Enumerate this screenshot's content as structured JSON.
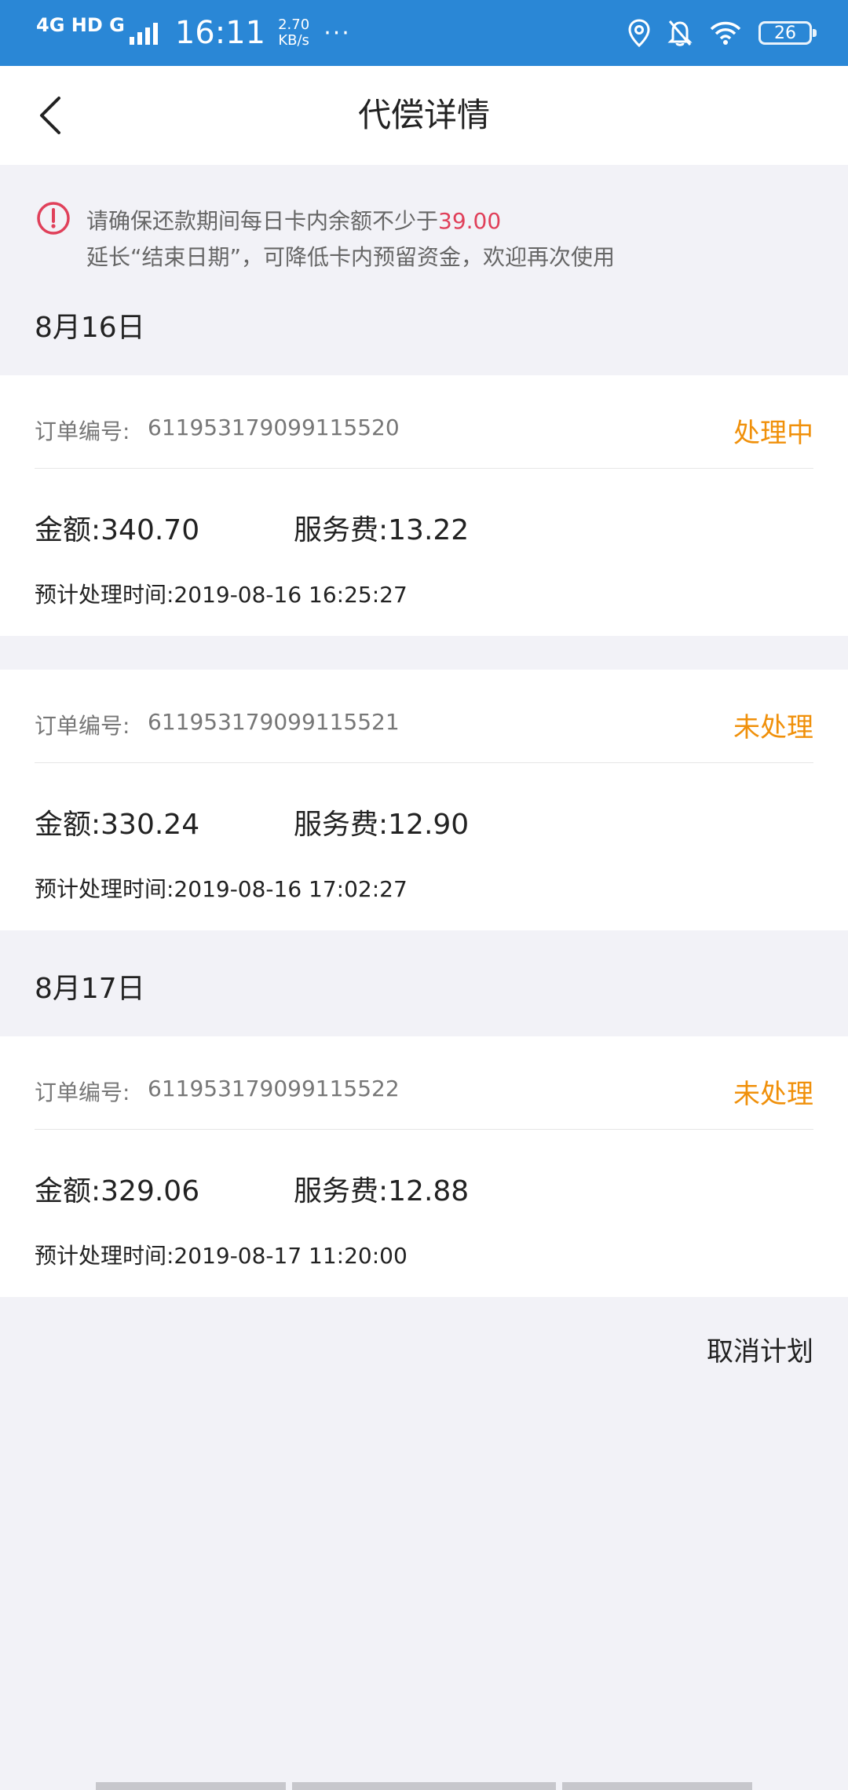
{
  "status_bar": {
    "network": "4G HD G",
    "time": "16:11",
    "speed_value": "2.70",
    "speed_unit": "KB/s",
    "more": "···",
    "battery": "26"
  },
  "header": {
    "title": "代偿详情"
  },
  "notice": {
    "line1_prefix": "请确保还款期间每日卡内余额不少于",
    "line1_amount": "39.00",
    "line2": "延长“结束日期”，可降低卡内预留资金，欢迎再次使用",
    "accent_color": "#e0405a"
  },
  "groups": [
    {
      "date": "8月16日",
      "orders": [
        {
          "order_label": "订单编号:",
          "order_no": "611953179099115520",
          "status": "处理中",
          "amount": "金额:340.70",
          "fee": "服务费:13.22",
          "time": "预计处理时间:2019-08-16 16:25:27"
        },
        {
          "order_label": "订单编号:",
          "order_no": "611953179099115521",
          "status": "未处理",
          "amount": "金额:330.24",
          "fee": "服务费:12.90",
          "time": "预计处理时间:2019-08-16 17:02:27"
        }
      ]
    },
    {
      "date": "8月17日",
      "orders": [
        {
          "order_label": "订单编号:",
          "order_no": "611953179099115522",
          "status": "未处理",
          "amount": "金额:329.06",
          "fee": "服务费:12.88",
          "time": "预计处理时间:2019-08-17 11:20:00"
        }
      ]
    }
  ],
  "footer": {
    "cancel_label": "取消计划"
  },
  "colors": {
    "status_bar": "#2a87d6",
    "status_text": "#f0900a",
    "background": "#f2f2f7"
  }
}
